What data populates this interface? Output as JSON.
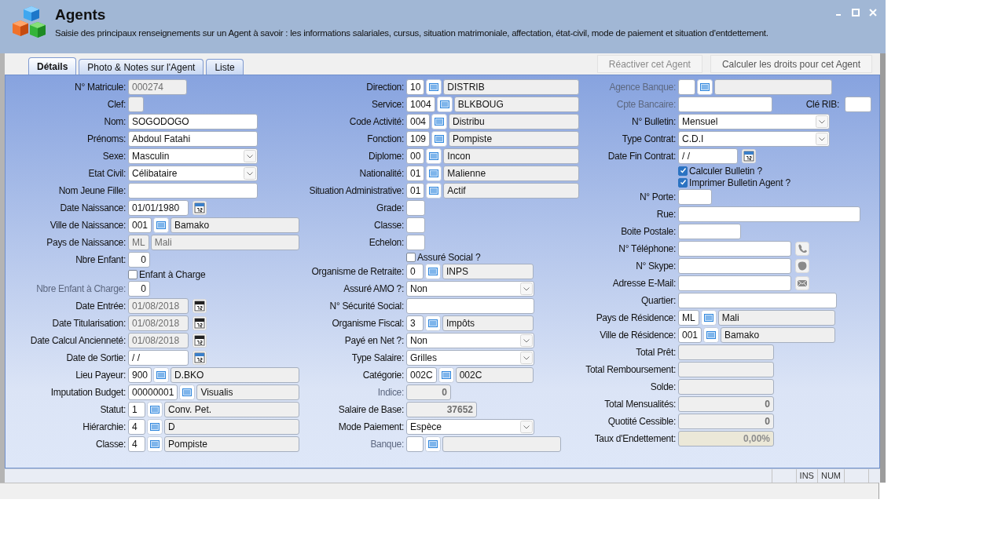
{
  "window": {
    "title": "Agents",
    "description": "Saisie des principaux renseignements sur un Agent à savoir : les informations salariales, cursus, situation matrimoniale, affectation, état-civil, mode de paiement et situation d'entdettement."
  },
  "tabs": [
    {
      "label": "Détails",
      "selected": true
    },
    {
      "label": "Photo & Notes sur l'Agent",
      "selected": false
    },
    {
      "label": "Liste",
      "selected": false
    }
  ],
  "actions": [
    {
      "label": "Réactiver cet Agent",
      "disabled": true
    },
    {
      "label": "Calculer les droits pour cet Agent",
      "disabled": false
    }
  ],
  "columns": [
    {
      "rows": [
        {
          "kind": "text",
          "label": "N° Matricule:",
          "value": "000274",
          "readonly": true,
          "disabled": false
        },
        {
          "kind": "text",
          "label": "Clef:",
          "readonly": true,
          "disabled": false
        },
        {
          "kind": "text",
          "label": "Nom:",
          "value": "SOGODOGO",
          "readonly": false,
          "disabled": false
        },
        {
          "kind": "text",
          "label": "Prénoms:",
          "value": "Abdoul Fatahi",
          "readonly": false,
          "disabled": false
        },
        {
          "kind": "select",
          "label": "Sexe:",
          "value": "Masculin",
          "disabled": false
        },
        {
          "kind": "select",
          "label": "Etat Civil:",
          "value": "Célibataire",
          "disabled": false
        },
        {
          "kind": "text",
          "label": "Nom Jeune Fille:",
          "readonly": false,
          "disabled": false
        },
        {
          "kind": "date",
          "label": "Date Naissance:",
          "value": "01/01/1980",
          "readonly": false,
          "disabled": false
        },
        {
          "kind": "lookup",
          "label": "Ville de Naissance:",
          "code": "001",
          "name": "Bamako",
          "readonly": false,
          "disabled": false
        },
        {
          "kind": "lookup",
          "label": "Pays de Naissance:",
          "code": "ML",
          "name": "Mali",
          "readonly": true,
          "disabled": false
        },
        {
          "kind": "number",
          "label": "Nbre Enfant:",
          "value": "0",
          "readonly": false,
          "disabled": false
        },
        {
          "kind": "checkbox",
          "label": "Enfant à Charge",
          "checked": false,
          "disabled": false
        },
        {
          "kind": "number",
          "label": "Nbre Enfant à Charge:",
          "value": "0",
          "readonly": false,
          "disabled": true
        },
        {
          "kind": "date",
          "label": "Date Entrée:",
          "value": "01/08/2018",
          "readonly": true,
          "disabled": false
        },
        {
          "kind": "date",
          "label": "Date Titularisation:",
          "value": "01/08/2018",
          "readonly": true,
          "disabled": false
        },
        {
          "kind": "date",
          "label": "Date Calcul Ancienneté:",
          "value": "01/08/2018",
          "readonly": true,
          "disabled": false
        },
        {
          "kind": "date",
          "label": "Date de Sortie:",
          "value": "/ /",
          "readonly": false,
          "disabled": false
        },
        {
          "kind": "lookup",
          "label": "Lieu Payeur:",
          "code": "900",
          "name": "D.BKO",
          "readonly": false,
          "disabled": false
        },
        {
          "kind": "lookup",
          "label": "Imputation Budget:",
          "code": "00000001",
          "name": "Visualis",
          "readonly": false,
          "disabled": false
        },
        {
          "kind": "lookup",
          "label": "Statut:",
          "code": "1",
          "name": "Conv. Pet.",
          "readonly": false,
          "disabled": false
        },
        {
          "kind": "lookup",
          "label": "Hiérarchie:",
          "code": "4",
          "name": "D",
          "readonly": false,
          "disabled": false
        },
        {
          "kind": "lookup",
          "label": "Classe:",
          "code": "4",
          "name": "Pompiste",
          "readonly": false,
          "disabled": false
        }
      ]
    },
    {
      "rows": [
        {
          "kind": "lookup",
          "label": "Direction:",
          "code": "10",
          "name": "DISTRIB",
          "readonly": false,
          "disabled": false
        },
        {
          "kind": "lookup",
          "label": "Service:",
          "code": "1004",
          "name": "BLKBOUG",
          "readonly": false,
          "disabled": false
        },
        {
          "kind": "lookup",
          "label": "Code Activité:",
          "code": "004",
          "name": "Distribu",
          "readonly": false,
          "disabled": false
        },
        {
          "kind": "lookup",
          "label": "Fonction:",
          "code": "109",
          "name": "Pompiste",
          "readonly": false,
          "disabled": false
        },
        {
          "kind": "lookup",
          "label": "Diplome:",
          "code": "00",
          "name": "Incon",
          "readonly": false,
          "disabled": false
        },
        {
          "kind": "lookup",
          "label": "Nationalité:",
          "code": "01",
          "name": "Malienne",
          "readonly": false,
          "disabled": false
        },
        {
          "kind": "lookup",
          "label": "Situation Administrative:",
          "code": "01",
          "name": "Actif",
          "readonly": false,
          "disabled": false
        },
        {
          "kind": "text",
          "label": "Grade:",
          "readonly": false,
          "disabled": false
        },
        {
          "kind": "text",
          "label": "Classe:",
          "readonly": false,
          "disabled": false
        },
        {
          "kind": "text",
          "label": "Echelon:",
          "readonly": false,
          "disabled": false
        },
        {
          "kind": "checkbox",
          "label": "Assuré Social ?",
          "checked": false,
          "disabled": false
        },
        {
          "kind": "lookup",
          "label": "Organisme de Retraite:",
          "code": "0",
          "name": "INPS",
          "readonly": false,
          "disabled": false
        },
        {
          "kind": "select",
          "label": "Assuré AMO ?:",
          "value": "Non",
          "disabled": false
        },
        {
          "kind": "text",
          "label": "N° Sécurité Social:",
          "readonly": false,
          "disabled": false
        },
        {
          "kind": "lookup",
          "label": "Organisme Fiscal:",
          "code": "3",
          "name": "Impôts",
          "readonly": false,
          "disabled": false
        },
        {
          "kind": "select",
          "label": "Payé en Net ?:",
          "value": "Non",
          "disabled": false
        },
        {
          "kind": "select",
          "label": "Type Salaire:",
          "value": "Grilles",
          "disabled": false
        },
        {
          "kind": "lookup",
          "label": "Catégorie:",
          "code": "002C",
          "name": "002C",
          "readonly": false,
          "disabled": false
        },
        {
          "kind": "number",
          "label": "Indice:",
          "value": "0",
          "readonly": true,
          "disabled": true
        },
        {
          "kind": "number",
          "label": "Salaire de Base:",
          "value": "37652",
          "readonly": true,
          "disabled": false
        },
        {
          "kind": "select",
          "label": "Mode Paiement:",
          "value": "Espèce",
          "disabled": false
        },
        {
          "kind": "lookup",
          "label": "Banque:",
          "readonly": false,
          "disabled": true
        }
      ]
    },
    {
      "rows": [
        {
          "kind": "lookup",
          "label": "Agence Banque:",
          "readonly": false,
          "disabled": true
        },
        {
          "kind": "text",
          "label": "Cpte Bancaire:",
          "readonly": false,
          "disabled": true,
          "extra": {
            "label": "Clé RIB:"
          }
        },
        {
          "kind": "select",
          "label": "N° Bulletin:",
          "value": "Mensuel",
          "disabled": false
        },
        {
          "kind": "select",
          "label": "Type Contrat:",
          "value": "C.D.I",
          "disabled": false
        },
        {
          "kind": "date",
          "label": "Date Fin Contrat:",
          "value": "/ /",
          "readonly": false,
          "disabled": false
        },
        {
          "kind": "checkbox",
          "label": "Calculer Bulletin ?",
          "checked": true,
          "disabled": false
        },
        {
          "kind": "checkbox",
          "label": "Imprimer Bulletin Agent ?",
          "checked": true,
          "disabled": false
        },
        {
          "kind": "text",
          "label": "N° Porte:",
          "readonly": false,
          "disabled": false
        },
        {
          "kind": "text",
          "label": "Rue:",
          "readonly": false,
          "disabled": false
        },
        {
          "kind": "text",
          "label": "Boite Postale:",
          "readonly": false,
          "disabled": false
        },
        {
          "kind": "phone",
          "label": "N° Téléphone:",
          "readonly": false,
          "disabled": false
        },
        {
          "kind": "chat",
          "label": "N° Skype:",
          "readonly": false,
          "disabled": false
        },
        {
          "kind": "email",
          "label": "Adresse E-Mail:",
          "readonly": false,
          "disabled": false
        },
        {
          "kind": "text",
          "label": "Quartier:",
          "readonly": false,
          "disabled": false
        },
        {
          "kind": "lookup",
          "label": "Pays de Résidence:",
          "code": "ML",
          "name": "Mali",
          "readonly": false,
          "disabled": false
        },
        {
          "kind": "lookup",
          "label": "Ville de Résidence:",
          "code": "001",
          "name": "Bamako",
          "readonly": false,
          "disabled": false
        },
        {
          "kind": "number",
          "label": "Total Prêt:",
          "readonly": true,
          "disabled": false
        },
        {
          "kind": "number",
          "label": "Total Remboursement:",
          "readonly": true,
          "disabled": false
        },
        {
          "kind": "number",
          "label": "Solde:",
          "readonly": true,
          "disabled": false
        },
        {
          "kind": "number",
          "label": "Total Mensualités:",
          "value": "0",
          "readonly": true,
          "disabled": false
        },
        {
          "kind": "number",
          "label": "Quotité Cessible:",
          "value": "0",
          "readonly": true,
          "disabled": false
        },
        {
          "kind": "ratio",
          "label": "Taux d'Endettement:",
          "value": "0,00%",
          "readonly": true,
          "disabled": false
        }
      ]
    }
  ],
  "status_bar": {
    "panels": [
      "INS",
      "NUM"
    ]
  }
}
